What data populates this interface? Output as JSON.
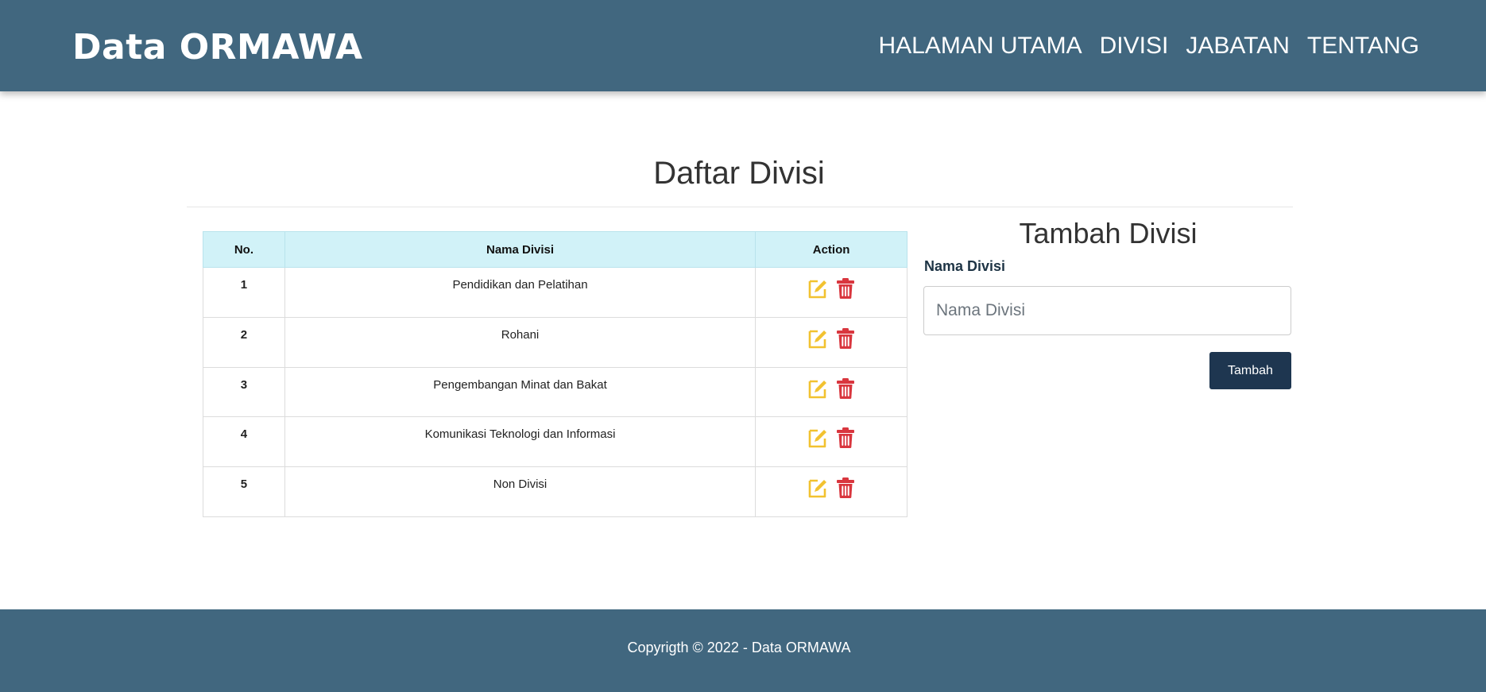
{
  "header": {
    "brand": "Data ORMAWA",
    "nav": [
      "HALAMAN UTAMA",
      "DIVISI",
      "JABATAN",
      "TENTANG"
    ]
  },
  "main": {
    "title": "Daftar Divisi",
    "table": {
      "headers": [
        "No.",
        "Nama Divisi",
        "Action"
      ],
      "rows": [
        {
          "no": "1",
          "name": "Pendidikan dan Pelatihan"
        },
        {
          "no": "2",
          "name": "Rohani"
        },
        {
          "no": "3",
          "name": "Pengembangan Minat dan Bakat"
        },
        {
          "no": "4",
          "name": "Komunikasi Teknologi dan Informasi"
        },
        {
          "no": "5",
          "name": "Non Divisi"
        }
      ],
      "action_icons": [
        "edit-icon",
        "trash-icon"
      ]
    },
    "form": {
      "title": "Tambah Divisi",
      "label": "Nama Divisi",
      "placeholder": "Nama Divisi",
      "value": "",
      "submit_label": "Tambah"
    }
  },
  "footer": {
    "text": "Copyrigth © 2022 - Data ORMAWA"
  },
  "colors": {
    "header_bg": "#41677f",
    "table_header_bg": "#d1f2f8",
    "edit_icon": "#f2c230",
    "delete_icon": "#d9363e",
    "button_bg": "#1e3650"
  }
}
